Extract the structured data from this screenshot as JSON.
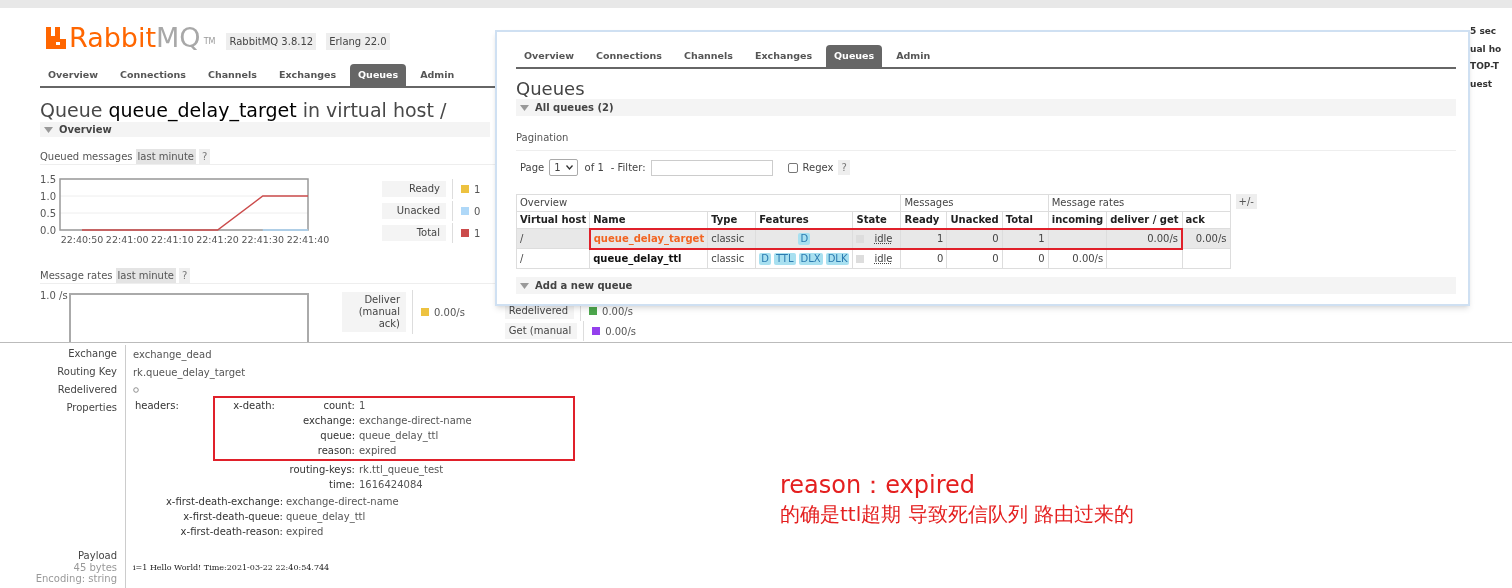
{
  "main_page": {
    "logo": {
      "name": "Rabbit",
      "suffix": "MQ",
      "tm": "TM"
    },
    "versions": [
      "RabbitMQ 3.8.12",
      "Erlang 22.0"
    ],
    "tabs": [
      {
        "label": "Overview",
        "selected": false
      },
      {
        "label": "Connections",
        "selected": false
      },
      {
        "label": "Channels",
        "selected": false
      },
      {
        "label": "Exchanges",
        "selected": false
      },
      {
        "label": "Queues",
        "selected": true
      },
      {
        "label": "Admin",
        "selected": false
      }
    ],
    "heading": {
      "prefix": "Queue",
      "queue": "queue_delay_target",
      "suffix": "in virtual host /"
    },
    "section": "Overview",
    "queued_messages": {
      "label": "Queued messages",
      "range": "last minute",
      "help": "?",
      "chart_data": {
        "type": "line",
        "categories": [
          "22:40:50",
          "22:41:00",
          "22:41:10",
          "22:41:20",
          "22:41:30",
          "22:41:40"
        ],
        "ylim": [
          0,
          1.5
        ],
        "yticks": [
          {
            "value": 0,
            "label": "0.0"
          },
          {
            "value": 0.5,
            "label": "0.5"
          },
          {
            "value": 1,
            "label": "1.0"
          },
          {
            "value": 1.5,
            "label": "1.5"
          }
        ],
        "series": [
          {
            "name": "Ready",
            "color": "#edc240",
            "values": [
              null,
              null,
              null,
              null,
              null,
              null
            ]
          },
          {
            "name": "Unacked",
            "color": "#afd8f8",
            "values": [
              null,
              null,
              null,
              null,
              0,
              0
            ]
          },
          {
            "name": "Total",
            "color": "#cb4b4b",
            "values": [
              0,
              0,
              0,
              0,
              1,
              1
            ]
          }
        ]
      },
      "legend_values": [
        "1",
        "0",
        "1"
      ]
    },
    "message_rates": {
      "label": "Message rates",
      "range": "last minute",
      "help": "?",
      "y_tick": "1.0 /s",
      "legend_columns": [
        [
          {
            "label": "Deliver (manual ack)",
            "color": "#edc240",
            "value": "0.00/s"
          }
        ],
        [
          {
            "label": "Redelivered",
            "color": "#4da74d",
            "value": "0.00/s"
          },
          {
            "label": "Get (manual",
            "color": "#9440ed",
            "value": "0.00/s"
          }
        ]
      ]
    },
    "edge_fragments": [
      "5 sec",
      "ual ho",
      "TOP-T",
      "uest"
    ]
  },
  "queues_window": {
    "tabs": [
      {
        "label": "Overview",
        "selected": false
      },
      {
        "label": "Connections",
        "selected": false
      },
      {
        "label": "Channels",
        "selected": false
      },
      {
        "label": "Exchanges",
        "selected": false
      },
      {
        "label": "Queues",
        "selected": true
      },
      {
        "label": "Admin",
        "selected": false
      }
    ],
    "title": "Queues",
    "section": "All queues (2)",
    "pagination": {
      "label": "Pagination",
      "page_label": "Page",
      "page": "1",
      "of": "of 1",
      "filter_label": "- Filter:",
      "regex_label": "Regex",
      "regex_checked": false,
      "help": "?"
    },
    "table": {
      "groups": [
        "Overview",
        "Messages",
        "Message rates"
      ],
      "toggle": "+/-",
      "columns": [
        "Virtual host",
        "Name",
        "Type",
        "Features",
        "State",
        "Ready",
        "Unacked",
        "Total",
        "incoming",
        "deliver / get",
        "ack"
      ],
      "rows": [
        {
          "selected": true,
          "vhost": "/",
          "name": "queue_delay_target",
          "type": "classic",
          "features": [
            "D"
          ],
          "state": "idle",
          "ready": "1",
          "unacked": "0",
          "total": "1",
          "deliver_get": "0.00/s",
          "ack": "0.00/s"
        },
        {
          "selected": false,
          "vhost": "/",
          "name": "queue_delay_ttl",
          "type": "classic",
          "features": [
            "D",
            "TTL",
            "DLX",
            "DLK"
          ],
          "state": "idle",
          "ready": "0",
          "unacked": "0",
          "total": "0",
          "incoming": "0.00/s"
        }
      ]
    },
    "add_section": "Add a new queue"
  },
  "message": {
    "fields": [
      {
        "kind": "text",
        "label": "Exchange",
        "value": "exchange_dead"
      },
      {
        "kind": "text",
        "label": "Routing Key",
        "value": "rk.queue_delay_target"
      },
      {
        "kind": "flag",
        "label": "Redelivered",
        "on": false
      }
    ],
    "properties": {
      "label": "Properties",
      "headers_label": "headers:",
      "x_death_label": "x-death:",
      "x_death": [
        {
          "key": "count:",
          "value": "1"
        },
        {
          "key": "exchange:",
          "value": "exchange-direct-name"
        },
        {
          "key": "queue:",
          "value": "queue_delay_ttl"
        },
        {
          "key": "reason:",
          "value": "expired"
        },
        {
          "key": "routing-keys:",
          "value": "rk.ttl_queue_test"
        },
        {
          "key": "time:",
          "value": "1616424084"
        }
      ],
      "first_death": [
        {
          "key": "x-first-death-exchange:",
          "value": "exchange-direct-name"
        },
        {
          "key": "x-first-death-queue:",
          "value": "queue_delay_ttl"
        },
        {
          "key": "x-first-death-reason:",
          "value": "expired"
        }
      ]
    },
    "payload": {
      "label": "Payload",
      "size": "45 bytes",
      "encoding": "Encoding: string",
      "body": "i=1 Hello World! Time:2021-03-22 22:40:54.744"
    }
  },
  "annotation": {
    "lines": [
      "reason：expired",
      "的确是ttl超期 导致死信队列 路由过来的"
    ]
  }
}
